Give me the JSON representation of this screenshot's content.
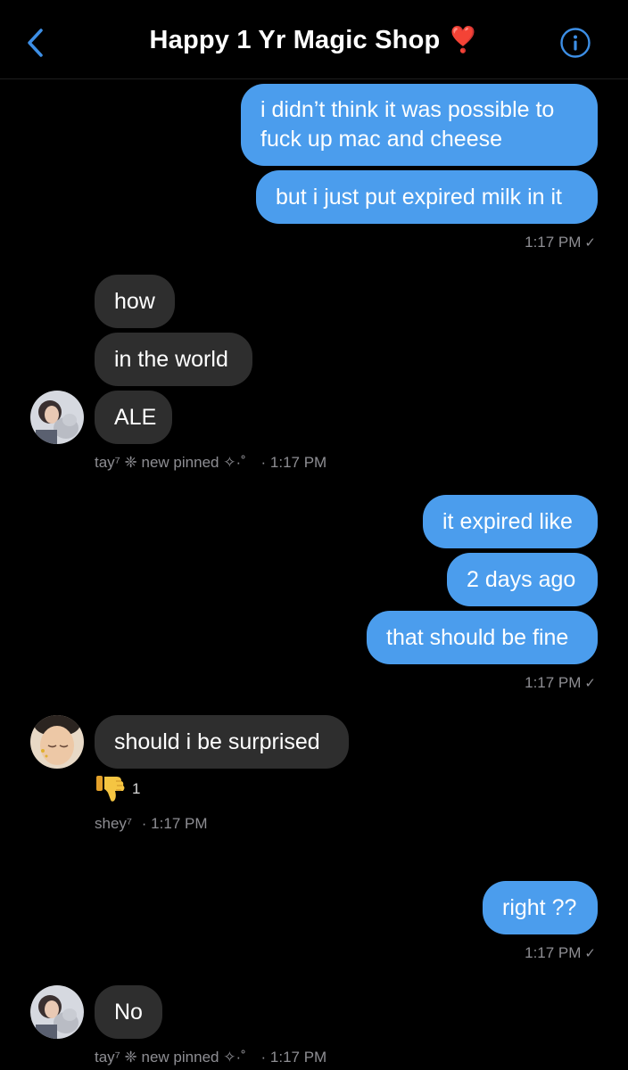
{
  "header": {
    "title": "Happy 1 Yr Magic Shop",
    "title_emoji": "❣️"
  },
  "messages": [
    {
      "id": "m1",
      "dir": "out",
      "text": "i didn’t think it was possible to\nfuck up mac and cheese"
    },
    {
      "id": "m2",
      "dir": "out",
      "text": "but i just put expired milk in it"
    },
    {
      "id": "meta1",
      "time": "1:17 PM"
    },
    {
      "id": "m3",
      "dir": "in",
      "text": "how"
    },
    {
      "id": "m4",
      "dir": "in",
      "text": "in the world"
    },
    {
      "id": "m5",
      "dir": "in",
      "text": "ALE"
    },
    {
      "id": "meta2",
      "sender": "tay⁷ ❈ new pinned ✧·˚",
      "time": "· 1:17 PM"
    },
    {
      "id": "m6",
      "dir": "out",
      "text": "it expired like"
    },
    {
      "id": "m7",
      "dir": "out",
      "text": "2 days ago"
    },
    {
      "id": "m8",
      "dir": "out",
      "text": "that should be fine"
    },
    {
      "id": "meta3",
      "time": "1:17 PM"
    },
    {
      "id": "m9",
      "dir": "in",
      "text": "should i be surprised"
    },
    {
      "id": "meta4",
      "sender": "shey⁷",
      "time": "· 1:17 PM"
    },
    {
      "id": "m10",
      "dir": "out",
      "text": "right ??"
    },
    {
      "id": "meta5",
      "time": "1:17 PM"
    },
    {
      "id": "m11",
      "dir": "in",
      "text": "No"
    },
    {
      "id": "meta6",
      "sender": "tay⁷ ❈ new pinned ✧·˚",
      "time": "· 1:17 PM"
    }
  ],
  "reaction": {
    "emoji_name": "thumbs-down",
    "count": "1"
  },
  "colors": {
    "outgoing": "#4b9ded",
    "incoming": "#2e2e2e",
    "accent": "#3d8fe6",
    "timestamp": "#8e8e93"
  }
}
